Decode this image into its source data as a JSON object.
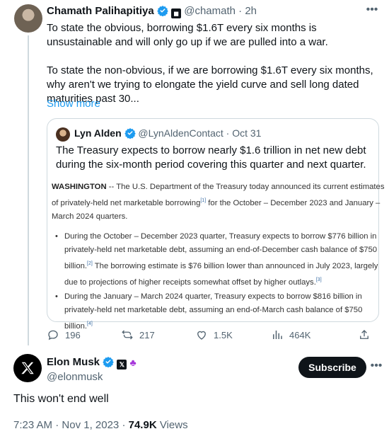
{
  "tweet1": {
    "author_name": "Chamath Palihapitiya",
    "handle": "@chamath",
    "separator": "·",
    "time": "2h",
    "paragraph1": "To state the obvious, borrowing $1.6T every six months is unsustainable and will only go up if we are pulled into a war.",
    "paragraph2": "To state the non-obvious, if we are borrowing $1.6T every six months, why aren't we trying to elongate the yield curve and sell long dated maturities past 30...",
    "show_more": "Show more"
  },
  "quote": {
    "author_name": "Lyn Alden",
    "handle": "@LynAldenContact",
    "separator": "·",
    "date": "Oct 31",
    "text": "The Treasury expects to borrow nearly $1.6 trillion in net new debt during the six-month period covering this quarter and next quarter.",
    "doc_lead": "WASHINGTON",
    "doc_intro_1": " -- The U.S. Department of the Treasury today announced its current estimates",
    "doc_intro_2": "of privately-held net marketable borrowing",
    "doc_intro_2_sup": "[1]",
    "doc_intro_2_end": " for the October – December 2023 and January –",
    "doc_intro_3": "March 2024 quarters.",
    "bullet1_line1": "During the October – December 2023 quarter, Treasury expects to borrow $776 billion in",
    "bullet1_line2": "privately-held net marketable debt, assuming an end-of-December cash balance of $750",
    "bullet1_line3a": "billion.",
    "bullet1_sup1": "[2]",
    "bullet1_line3b": "  The borrowing estimate is $76 billion lower than announced in July 2023, largely",
    "bullet1_line4": "due to projections of higher receipts somewhat offset by higher outlays.",
    "bullet1_sup2": "[3]",
    "bullet2_line1": "During the January – March 2024 quarter, Treasury expects to borrow $816 billion in",
    "bullet2_line2": "privately-held net marketable debt, assuming an end-of-March cash balance of $750",
    "bullet2_line3": "billion.",
    "bullet2_sup": "[4]"
  },
  "actions": {
    "replies": "196",
    "reposts": "217",
    "likes": "1.5K",
    "views": "464K"
  },
  "tweet2": {
    "author_name": "Elon Musk",
    "handle": "@elonmusk",
    "subscribe_label": "Subscribe",
    "text": "This won't end well",
    "time": "7:23 AM",
    "separator": "·",
    "date": "Nov 1, 2023",
    "separator2": "·",
    "views_count": "74.9K",
    "views_label": "Views"
  },
  "colors": {
    "verified_blue": "#1d9bf0",
    "link_blue": "#1d9bf0",
    "text_primary": "#0f1419",
    "text_secondary": "#536471",
    "border": "#cfd9de"
  },
  "icons": [
    "more-icon",
    "verified-badge-icon",
    "affiliate-badge-icon",
    "reply-icon",
    "repost-icon",
    "like-icon",
    "views-icon",
    "share-icon",
    "x-logo-icon",
    "grok-icon"
  ]
}
